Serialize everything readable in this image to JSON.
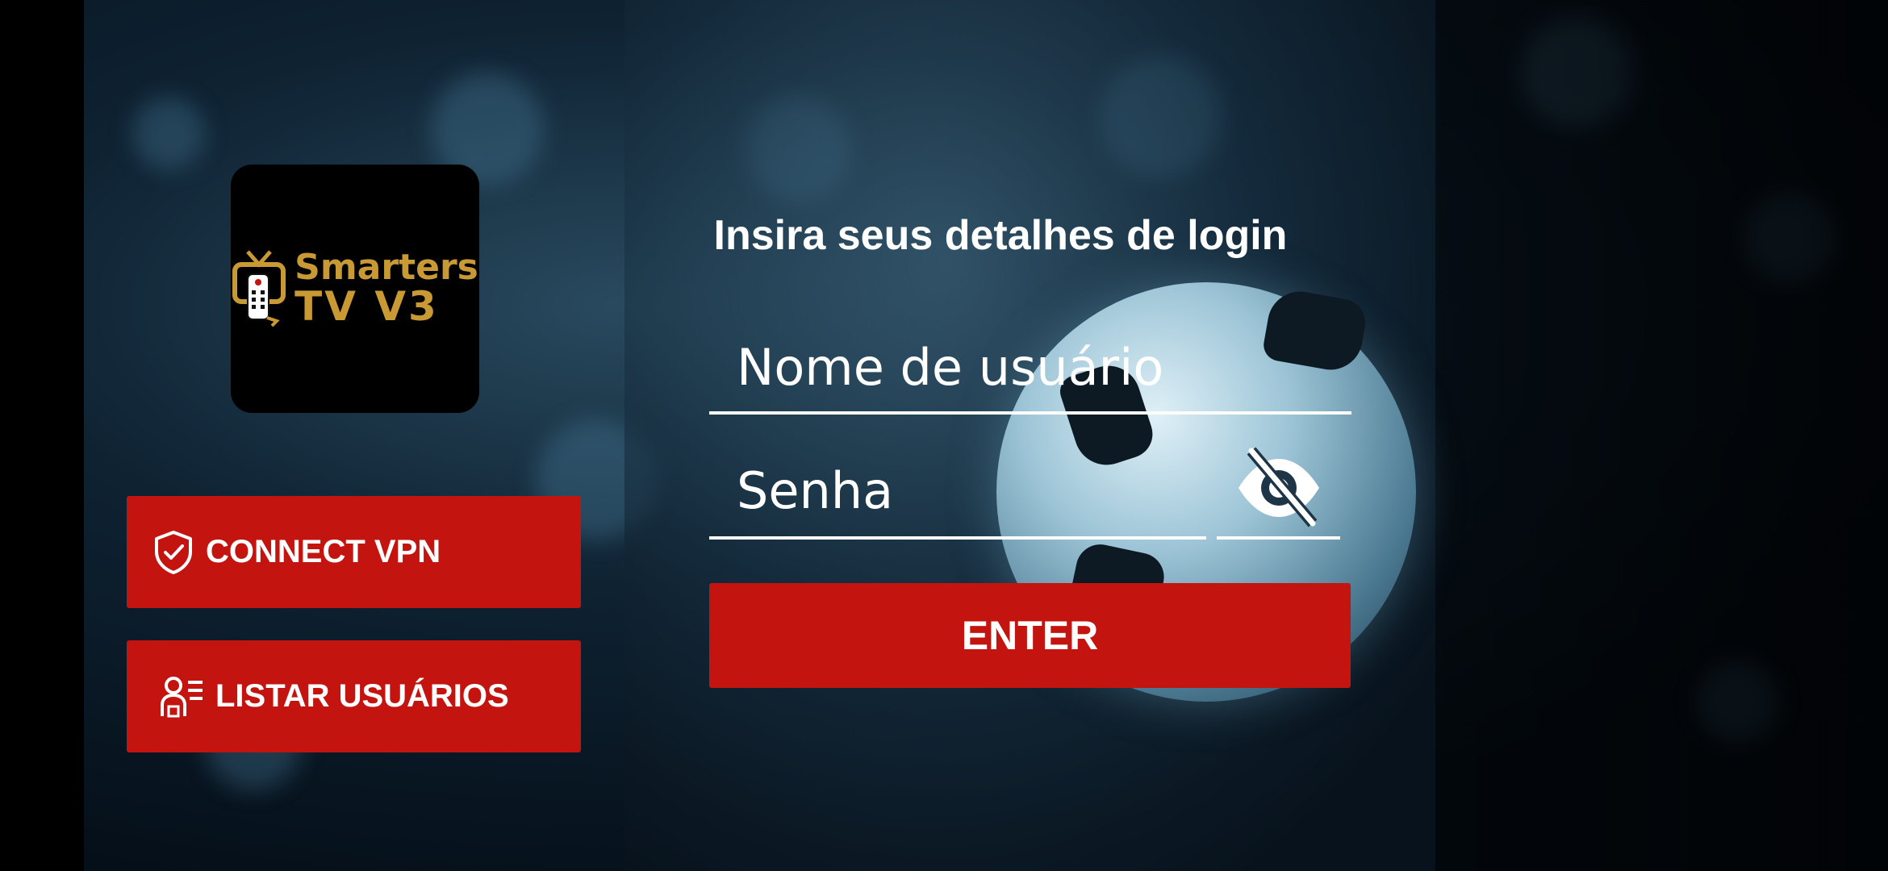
{
  "login": {
    "title": "Insira seus detalhes de login",
    "username_placeholder": "Nome de usuário",
    "password_placeholder": "Senha",
    "enter_label": "ENTER"
  },
  "logo": {
    "line1": "Smarters",
    "line2": "TV V3"
  },
  "sidebar": {
    "vpn_label": "CONNECT VPN",
    "users_label": "LISTAR USUÁRIOS"
  },
  "icons": {
    "vpn": "shield-check-icon",
    "users": "user-list-icon",
    "password_toggle": "eye-off-icon",
    "logo": "tv-remote-icon"
  },
  "colors": {
    "accent": "#c31410",
    "logo_gold": "#c99a34",
    "text": "#ffffff"
  }
}
